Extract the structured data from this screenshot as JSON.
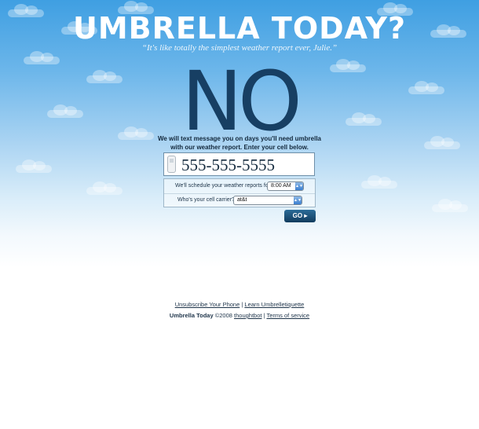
{
  "header": {
    "title": "UMBRELLA TODAY?",
    "tagline": "“It's like totally the simplest weather report ever, Julie.”"
  },
  "answer": "NO",
  "signup": {
    "intro_line1": "We will text message you on days you'll need umbrella",
    "intro_line2": "with our weather report. Enter your cell below.",
    "phone_value": "555-555-5555",
    "schedule_label": "We'll schedule your weather reports for",
    "schedule_value": "8:00 AM",
    "carrier_label": "Who's your cell carrier?",
    "carrier_value": "at&t",
    "go_label": "GO"
  },
  "footer": {
    "unsubscribe": "Unsubscribe Your Phone",
    "separator": "|",
    "learn": "Learn Umbrelletiquette",
    "brand": "Umbrella Today",
    "copyright": "©2008",
    "company": "thoughtbot",
    "terms": "Terms of service"
  },
  "colors": {
    "sky_top": "#3f9fe2",
    "answer": "#173f63",
    "button": "#113c5e"
  }
}
